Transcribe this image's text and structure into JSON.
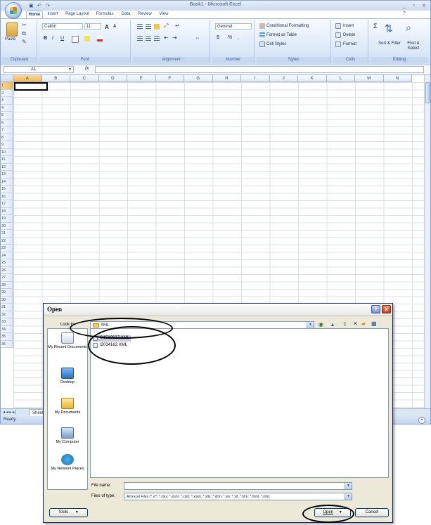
{
  "excel": {
    "qat_icons": [
      "save-icon",
      "undo-icon",
      "redo-icon"
    ],
    "title": "Book1 - Microsoft Excel",
    "window_controls": [
      "_",
      "▫",
      "x"
    ],
    "tabs": [
      "Home",
      "Insert",
      "Page Layout",
      "Formulas",
      "Data",
      "Review",
      "View"
    ],
    "active_tab": "Home",
    "ribbon": {
      "clipboard": {
        "label": "Clipboard",
        "paste": "Paste"
      },
      "font": {
        "label": "Font",
        "name": "Calibri",
        "size": "11",
        "bold": "B",
        "italic": "I",
        "underline": "U",
        "grow": "A",
        "shrink": "A"
      },
      "alignment": {
        "label": "Alignment"
      },
      "number": {
        "label": "Number",
        "format": "General",
        "currency": "$",
        "percent": "%",
        "comma": ","
      },
      "styles": {
        "label": "Styles",
        "conditional": "Conditional Formatting",
        "format_table": "Format as Table",
        "cell_styles": "Cell Styles"
      },
      "cells": {
        "label": "Cells",
        "insert": "Insert",
        "delete": "Delete",
        "format": "Format"
      },
      "editing": {
        "label": "Editing",
        "sum": "Σ",
        "sort_filter": "Sort & Filter",
        "find_select": "Find & Select"
      }
    },
    "name_box": "A1",
    "fx": "fx",
    "columns": [
      "A",
      "B",
      "C",
      "D",
      "E",
      "F",
      "G",
      "H",
      "I",
      "J",
      "K",
      "L",
      "M",
      "N"
    ],
    "rows": [
      "1",
      "2",
      "3",
      "4",
      "5",
      "6",
      "7",
      "8",
      "9",
      "10",
      "11",
      "12",
      "13",
      "14",
      "15",
      "16",
      "17",
      "18",
      "19",
      "20",
      "21",
      "22",
      "23",
      "24",
      "25",
      "26",
      "27",
      "28",
      "29",
      "30",
      "31",
      "32",
      "33",
      "34",
      "35",
      "36"
    ],
    "sheet_nav": "◂ ◂ ▸ ▸|",
    "sheet_tab": "Sheet1",
    "status": "Ready"
  },
  "dialog": {
    "title": "Open",
    "help_btn": "?",
    "close_btn": "X",
    "look_in_label": "Look in:",
    "look_in_value": "XML",
    "places": [
      "My Recent Documents",
      "Desktop",
      "My Documents",
      "My Computer",
      "My Network Places"
    ],
    "files": [
      "G1519637.XML",
      "I2034162.XML"
    ],
    "selected_file": "G1519637.XML",
    "file_name_label": "File name:",
    "file_name_value": "",
    "files_of_type_label": "Files of type:",
    "files_of_type_value": "All Excel Files (*.xl*; *.xlsx; *.xlsm; *.xlsb; *.xlam; *.xltx; *.xltm; *.xls; *.xlt; *.htm; *.html; *.mht;",
    "tools_label": "Tools",
    "open_label": "Open",
    "cancel_label": "Cancel"
  },
  "colors": {
    "accent": "#0a246a",
    "annotation": "#000000",
    "close_red": "#d9472f",
    "selection": "#c2cbe0"
  }
}
